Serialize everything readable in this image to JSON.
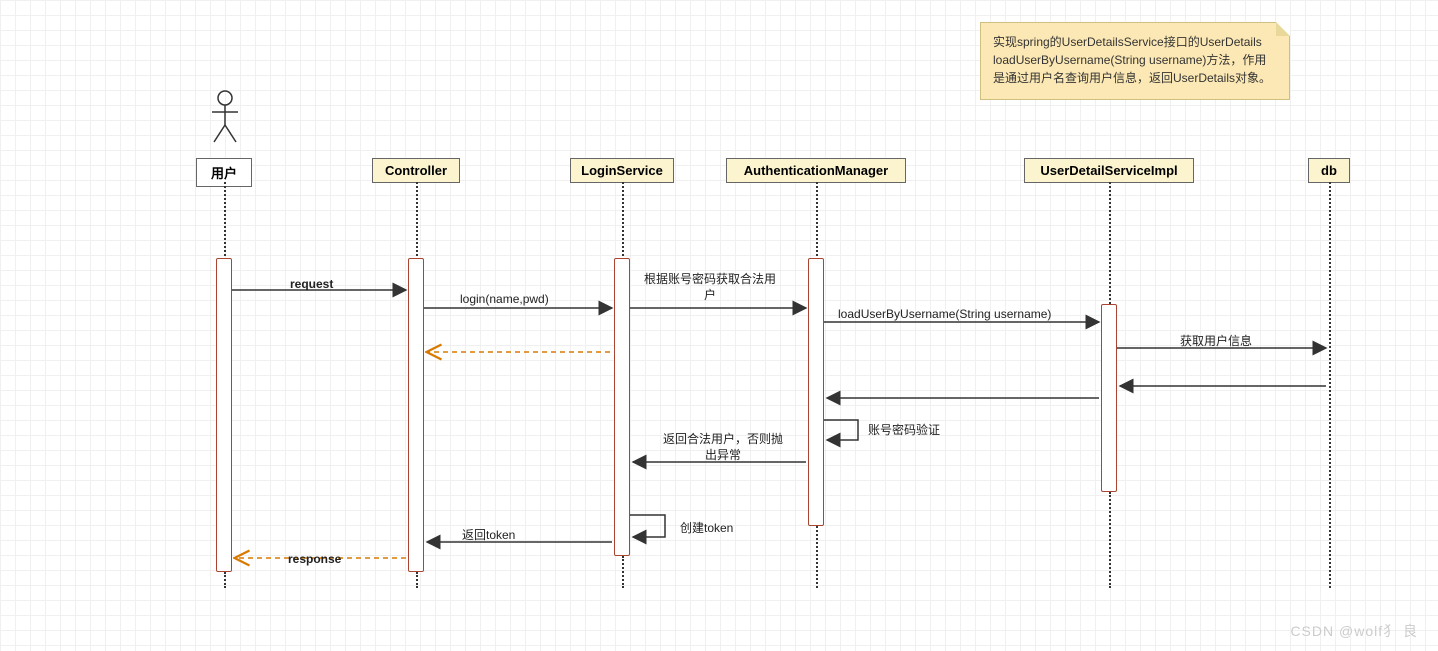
{
  "note": {
    "text": "实现spring的UserDetailsService接口的UserDetails loadUserByUsername(String username)方法，作用是通过用户名查询用户信息，返回UserDetails对象。"
  },
  "participants": {
    "user": "用户",
    "controller": "Controller",
    "loginService": "LoginService",
    "authManager": "AuthenticationManager",
    "userDetailService": "UserDetailServiceImpl",
    "db": "db"
  },
  "messages": {
    "request": "request",
    "login": "login(name,pwd)",
    "getLegalUser": "根据账号密码获取合法用户",
    "loadUser": "loadUserByUsername(String username)",
    "getUserInfo": "获取用户信息",
    "verify": "账号密码验证",
    "returnLegal": "返回合法用户，否则抛出异常",
    "createToken": "创建token",
    "returnToken": "返回token",
    "response": "response"
  },
  "watermark": "CSDN @wolf犭 良"
}
